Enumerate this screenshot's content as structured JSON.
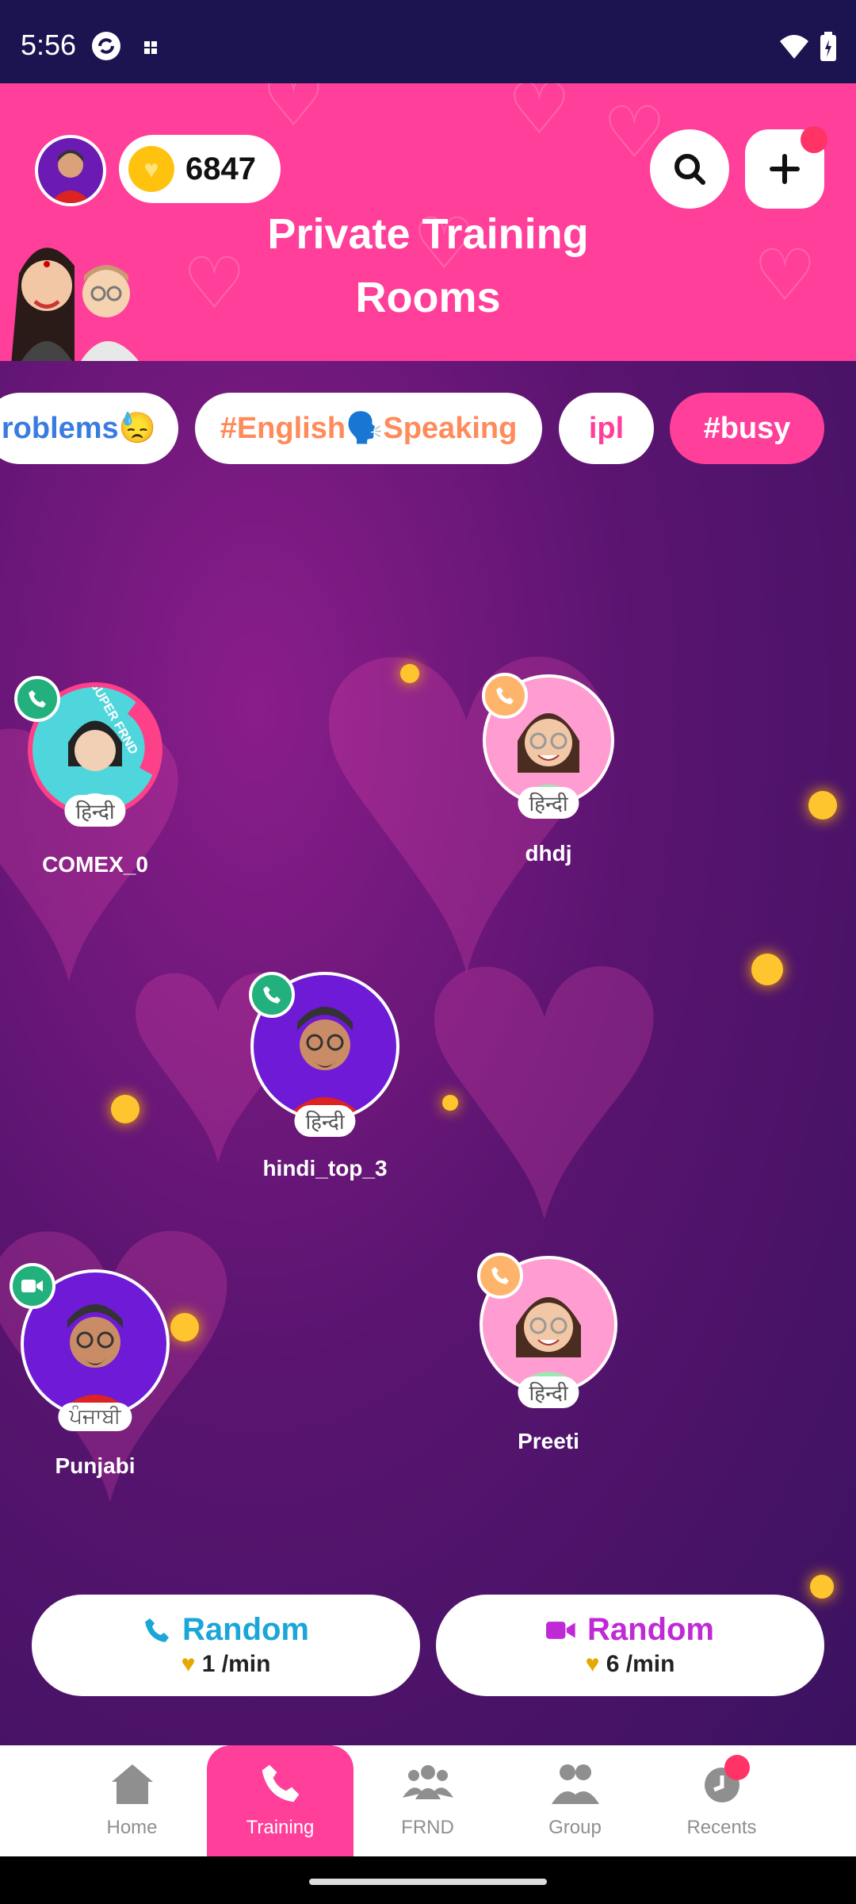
{
  "status_bar": {
    "time": "5:56"
  },
  "header": {
    "coins": "6847",
    "title_line1": "Private Training",
    "title_line2": "Rooms"
  },
  "tags": [
    "roblems😓",
    "#English🗣️Speaking",
    "ipl",
    "#busy"
  ],
  "users": [
    {
      "name": "COMEX_0",
      "lang": "हिन्दी",
      "badge": "super frnd",
      "call": "audio-green"
    },
    {
      "name": "dhdj",
      "lang": "हिन्दी",
      "call": "audio-orange"
    },
    {
      "name": "hindi_top_3",
      "lang": "हिन्दी",
      "call": "audio-green"
    },
    {
      "name": "Punjabi",
      "lang": "ਪੰਜਾਬੀ",
      "call": "video-green"
    },
    {
      "name": "Preeti",
      "lang": "हिन्दी",
      "call": "audio-orange"
    }
  ],
  "super_frnd_label": "SUPER FRND",
  "random_buttons": [
    {
      "label": "Random",
      "price": "1 /min",
      "color": "#1aa6d8",
      "icon": "phone-icon"
    },
    {
      "label": "Random",
      "price": "6 /min",
      "color": "#c02ad6",
      "icon": "video-icon"
    }
  ],
  "nav": {
    "items": [
      {
        "label": "Home",
        "icon": "home-icon"
      },
      {
        "label": "Training",
        "icon": "phone-icon"
      },
      {
        "label": "FRND",
        "icon": "friends-icon"
      },
      {
        "label": "Group",
        "icon": "group-icon"
      },
      {
        "label": "Recents",
        "icon": "clock-icon"
      }
    ],
    "active": "Training"
  },
  "colors": {
    "primary_pink": "#ff3f9a",
    "navy": "#1c1450",
    "green_call": "#22b07d",
    "orange_call": "#ffb46b"
  }
}
